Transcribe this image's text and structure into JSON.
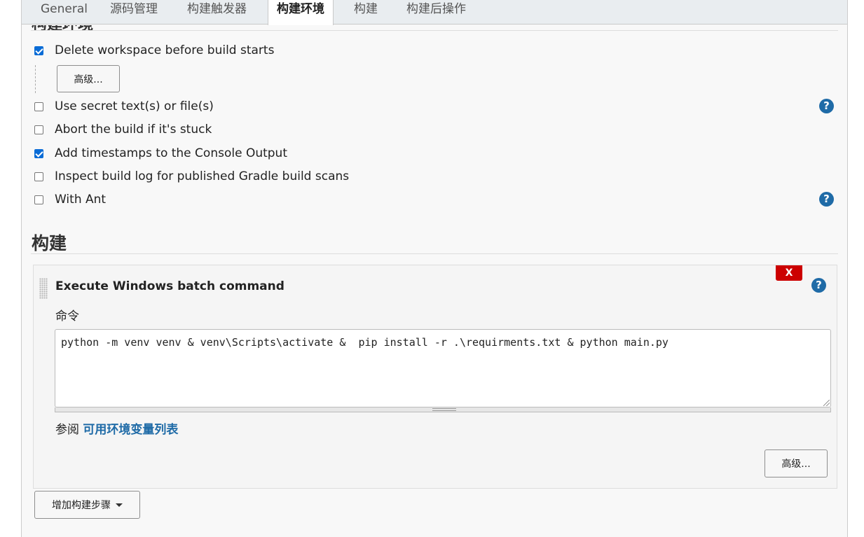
{
  "tabs": [
    {
      "label": "General",
      "active": false
    },
    {
      "label": "源码管理",
      "active": false
    },
    {
      "label": "构建触发器",
      "active": false
    },
    {
      "label": "构建环境",
      "active": true
    },
    {
      "label": "构建",
      "active": false
    },
    {
      "label": "构建后操作",
      "active": false
    }
  ],
  "build_env": {
    "section_heading": "构建环境",
    "options": [
      {
        "label": "Delete workspace before build starts",
        "checked": true,
        "help": false
      },
      {
        "label": "Use secret text(s) or file(s)",
        "checked": false,
        "help": true
      },
      {
        "label": "Abort the build if it's stuck",
        "checked": false,
        "help": false
      },
      {
        "label": "Add timestamps to the Console Output",
        "checked": true,
        "help": false
      },
      {
        "label": "Inspect build log for published Gradle build scans",
        "checked": false,
        "help": false
      },
      {
        "label": "With Ant",
        "checked": false,
        "help": true
      }
    ],
    "advanced_button": "高级..."
  },
  "build": {
    "heading": "构建",
    "step": {
      "title": "Execute Windows batch command",
      "delete_label": "X",
      "command_label": "命令",
      "command_value": "python -m venv venv & venv\\Scripts\\activate &  pip install -r .\\requirments.txt & python main.py",
      "see_prefix": "参阅",
      "env_vars_link": "可用环境变量列表",
      "advanced_button": "高级..."
    },
    "add_step_button": "增加构建步骤"
  },
  "icons": {
    "help": "help-icon",
    "checkbox": "checkbox",
    "drag": "drag-handle-icon",
    "dropdown": "caret-down-icon"
  },
  "colors": {
    "accent": "#1f6ba7",
    "checkbox": "#0a6cd6",
    "delete": "#cc0000"
  }
}
